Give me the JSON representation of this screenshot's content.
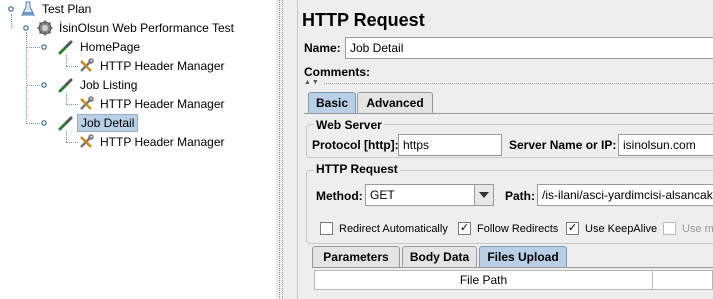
{
  "tree": {
    "items": [
      {
        "label": "Test Plan",
        "icon": "flask-icon"
      },
      {
        "label": "İsinOlsun Web Performance Test",
        "icon": "gear-icon"
      },
      {
        "label": "HomePage",
        "icon": "pipette-icon"
      },
      {
        "label": "HTTP Header Manager",
        "icon": "tools-icon"
      },
      {
        "label": "Job Listing",
        "icon": "pipette-icon"
      },
      {
        "label": "HTTP Header Manager",
        "icon": "tools-icon"
      },
      {
        "label": "Job Detail",
        "icon": "pipette-icon",
        "selected": true
      },
      {
        "label": "HTTP Header Manager",
        "icon": "tools-icon"
      }
    ]
  },
  "panel": {
    "title": "HTTP Request",
    "name_label": "Name:",
    "name_value": "Job Detail",
    "comments_label": "Comments:",
    "tabs": [
      "Basic",
      "Advanced"
    ],
    "active_tab": "Basic",
    "web_server": {
      "title": "Web Server",
      "protocol_label": "Protocol [http]:",
      "protocol_value": "https",
      "server_label": "Server Name or IP:",
      "server_value": "isinolsun.com"
    },
    "http_request": {
      "title": "HTTP Request",
      "method_label": "Method:",
      "method_value": "GET",
      "path_label": "Path:",
      "path_value": "/is-ilani/asci-yardimcisi-alsancak"
    },
    "options": [
      {
        "label": "Redirect Automatically",
        "checked": false,
        "disabled": false
      },
      {
        "label": "Follow Redirects",
        "checked": true,
        "disabled": false
      },
      {
        "label": "Use KeepAlive",
        "checked": true,
        "disabled": false
      },
      {
        "label": "Use mu",
        "checked": false,
        "disabled": true
      }
    ],
    "sub_tabs": [
      "Parameters",
      "Body Data",
      "Files Upload"
    ],
    "active_sub_tab": "Files Upload",
    "files_table": {
      "columns": [
        "File Path",
        ""
      ]
    }
  },
  "colors": {
    "selection": "#b8cfe5",
    "panel_bg": "#eeeeee"
  }
}
